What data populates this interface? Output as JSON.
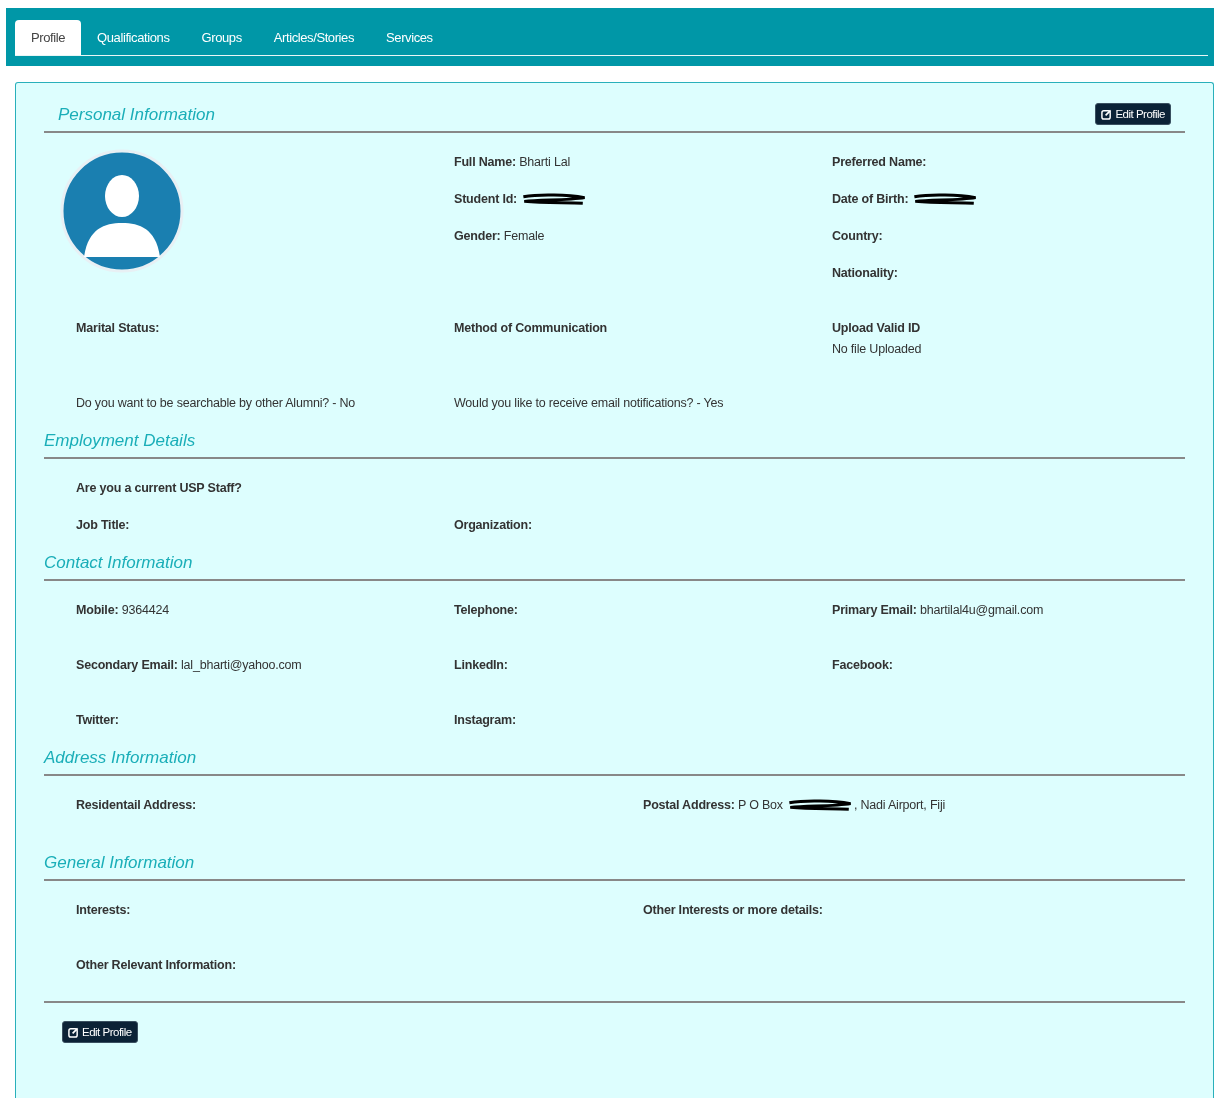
{
  "tabs": [
    {
      "label": "Profile",
      "selected": true
    },
    {
      "label": "Qualifications",
      "selected": false
    },
    {
      "label": "Groups",
      "selected": false
    },
    {
      "label": "Articles/Stories",
      "selected": false
    },
    {
      "label": "Services",
      "selected": false
    }
  ],
  "edit_button": "Edit Profile",
  "sections": [
    {
      "title": "Personal Information",
      "kind": "three-column",
      "edit_button": "Edit Profile",
      "rows": [
        [
          {
            "kind": "avatar"
          },
          {
            "kind": "fields",
            "items": [
              {
                "kind": "inline",
                "label": "Full Name:",
                "value": "Bharti Lal"
              },
              {
                "kind": "inline",
                "label": "Student Id:",
                "redacted": true
              },
              {
                "kind": "inline",
                "label": "Gender:",
                "value": "Female"
              }
            ]
          },
          {
            "kind": "fields",
            "items": [
              {
                "kind": "inline",
                "label": "Preferred Name:"
              },
              {
                "kind": "inline",
                "label": "Date of Birth:",
                "redacted": true
              },
              {
                "kind": "inline",
                "label": "Country:"
              },
              {
                "kind": "inline",
                "label": "Nationality:"
              }
            ]
          }
        ],
        [
          {
            "kind": "fields",
            "items": [
              {
                "kind": "inline",
                "label": "Marital Status:"
              }
            ]
          },
          {
            "kind": "fields",
            "items": [
              {
                "kind": "inline",
                "label": "Method of Communication"
              }
            ]
          },
          {
            "kind": "fields",
            "items": [
              {
                "kind": "stacked",
                "label": "Upload Valid ID",
                "value": "No file Uploaded"
              }
            ]
          }
        ],
        [
          {
            "kind": "fields",
            "items": [
              {
                "kind": "text",
                "value": "Do you want to be searchable by other Alumni? - No"
              }
            ]
          },
          {
            "kind": "fields",
            "items": [
              {
                "kind": "text",
                "value": "Would you like to receive email notifications? - Yes"
              }
            ]
          }
        ]
      ]
    },
    {
      "title": "Employment Details",
      "kind": "three-column",
      "rows": [
        [
          {
            "kind": "fields",
            "items": [
              {
                "kind": "inline",
                "label": "Are you a current USP Staff?"
              }
            ]
          }
        ],
        [
          {
            "kind": "fields",
            "items": [
              {
                "kind": "inline",
                "label": "Job Title:"
              }
            ]
          },
          {
            "kind": "fields",
            "items": [
              {
                "kind": "inline",
                "label": "Organization:"
              }
            ]
          }
        ]
      ]
    },
    {
      "title": "Contact Information",
      "kind": "three-column",
      "rows": [
        [
          {
            "kind": "fields",
            "items": [
              {
                "kind": "inline",
                "label": "Mobile:",
                "value": "9364424"
              }
            ]
          },
          {
            "kind": "fields",
            "items": [
              {
                "kind": "inline",
                "label": "Telephone:"
              }
            ]
          },
          {
            "kind": "fields",
            "items": [
              {
                "kind": "inline",
                "label": "Primary Email:",
                "value": "bhartilal4u@gmail.com"
              }
            ]
          }
        ],
        [
          {
            "kind": "fields",
            "items": [
              {
                "kind": "inline",
                "label": "Secondary Email:",
                "value": "lal_bharti@yahoo.com"
              }
            ]
          },
          {
            "kind": "fields",
            "items": [
              {
                "kind": "inline",
                "label": "LinkedIn:"
              }
            ]
          },
          {
            "kind": "fields",
            "items": [
              {
                "kind": "inline",
                "label": "Facebook:"
              }
            ]
          }
        ],
        [
          {
            "kind": "fields",
            "items": [
              {
                "kind": "inline",
                "label": "Twitter:"
              }
            ]
          },
          {
            "kind": "fields",
            "items": [
              {
                "kind": "inline",
                "label": "Instagram:"
              }
            ]
          }
        ]
      ]
    },
    {
      "title": "Address Information",
      "kind": "two-column",
      "rows": [
        [
          {
            "kind": "fields",
            "items": [
              {
                "kind": "inline",
                "label": "Residentail Address:"
              }
            ]
          },
          {
            "kind": "fields",
            "items": [
              {
                "kind": "inline",
                "label": "Postal Address:",
                "value": "P O Box",
                "redacted": true,
                "value_after": ", Nadi Airport, Fiji"
              }
            ]
          }
        ]
      ]
    },
    {
      "title": "General Information",
      "kind": "two-column",
      "rows": [
        [
          {
            "kind": "fields",
            "items": [
              {
                "kind": "inline",
                "label": "Interests:"
              }
            ]
          },
          {
            "kind": "fields",
            "items": [
              {
                "kind": "inline",
                "label": "Other Interests or more details:"
              }
            ]
          }
        ],
        [
          {
            "kind": "fields",
            "items": [
              {
                "kind": "inline",
                "label": "Other Relevant Information:"
              }
            ]
          }
        ]
      ]
    }
  ]
}
